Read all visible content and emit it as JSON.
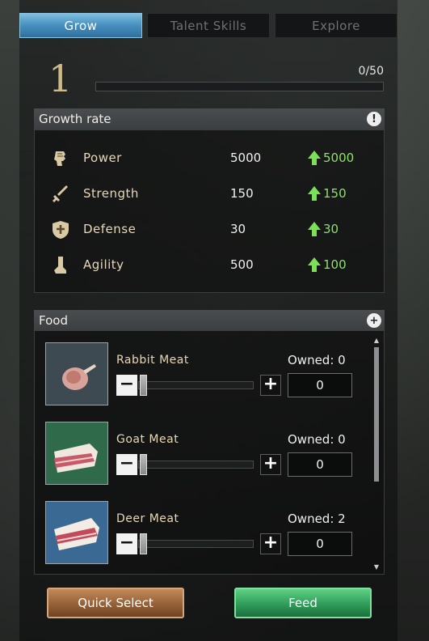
{
  "tabs": [
    {
      "label": "Grow",
      "active": true
    },
    {
      "label": "Talent Skills",
      "active": false
    },
    {
      "label": "Explore",
      "active": false
    }
  ],
  "level": {
    "value": "1",
    "exp_text": "0/50",
    "exp_progress": 0
  },
  "growth": {
    "title": "Growth rate",
    "info_icon": "exclamation-icon",
    "stats": [
      {
        "name": "Power",
        "value": "5000",
        "increase": "5000",
        "icon": "fist-icon"
      },
      {
        "name": "Strength",
        "value": "150",
        "increase": "150",
        "icon": "sword-icon"
      },
      {
        "name": "Defense",
        "value": "30",
        "increase": "30",
        "icon": "shield-icon"
      },
      {
        "name": "Agility",
        "value": "500",
        "increase": "100",
        "icon": "boot-icon"
      }
    ]
  },
  "food": {
    "title": "Food",
    "add_icon": "plus-icon",
    "items": [
      {
        "name": "Rabbit Meat",
        "owned": "Owned: 0",
        "quantity": "0",
        "color": "#3d4a52"
      },
      {
        "name": "Goat Meat",
        "owned": "Owned: 0",
        "quantity": "0",
        "color": "#2f6a4a"
      },
      {
        "name": "Deer Meat",
        "owned": "Owned: 2",
        "quantity": "0",
        "color": "#3a6a94"
      }
    ]
  },
  "buttons": {
    "quick_select": "Quick Select",
    "feed": "Feed"
  },
  "colors": {
    "accent_tab": "#4b93c2",
    "increase_green": "#8ee06f",
    "feed_green": "#2f9d5a",
    "quick_brown": "#9a643a"
  }
}
